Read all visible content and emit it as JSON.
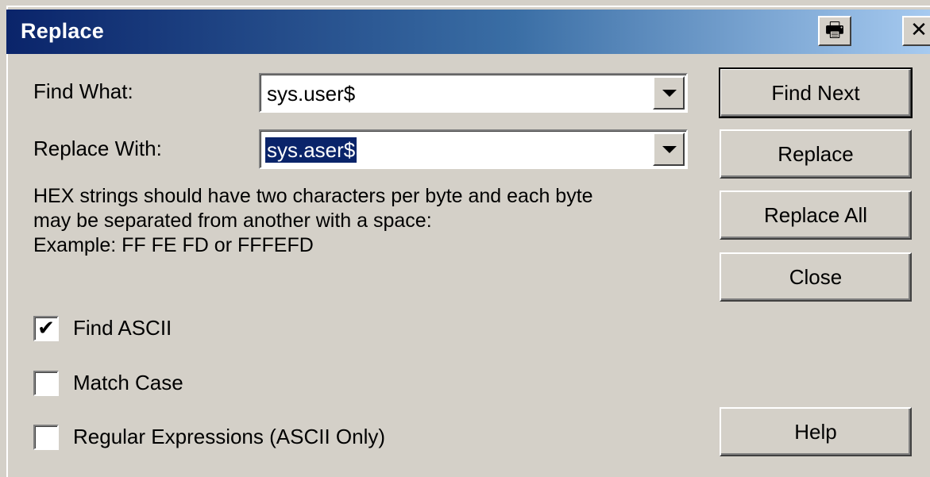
{
  "window": {
    "title": "Replace",
    "print_icon": "🖶",
    "close_icon": "✕"
  },
  "find": {
    "label": "Find What:",
    "value": "sys.user$"
  },
  "replace": {
    "label": "Replace With:",
    "value": "sys.aser$"
  },
  "help_text": [
    "HEX strings should have two characters per byte and each byte",
    "may be separated from another with a space:",
    "Example: FF FE FD  or FFFEFD"
  ],
  "options": [
    {
      "label": "Find ASCII",
      "checked": true,
      "mark": "✔"
    },
    {
      "label": "Match Case",
      "checked": false,
      "mark": ""
    },
    {
      "label": "Regular Expressions (ASCII Only)",
      "checked": false,
      "mark": ""
    }
  ],
  "buttons": {
    "find_next": "Find Next",
    "replace": "Replace",
    "replace_all": "Replace All",
    "close": "Close",
    "help": "Help"
  },
  "colors": {
    "face": "#d4d0c8",
    "title_start": "#0a246a",
    "title_end": "#a6caf0",
    "selection": "#0a246a"
  }
}
